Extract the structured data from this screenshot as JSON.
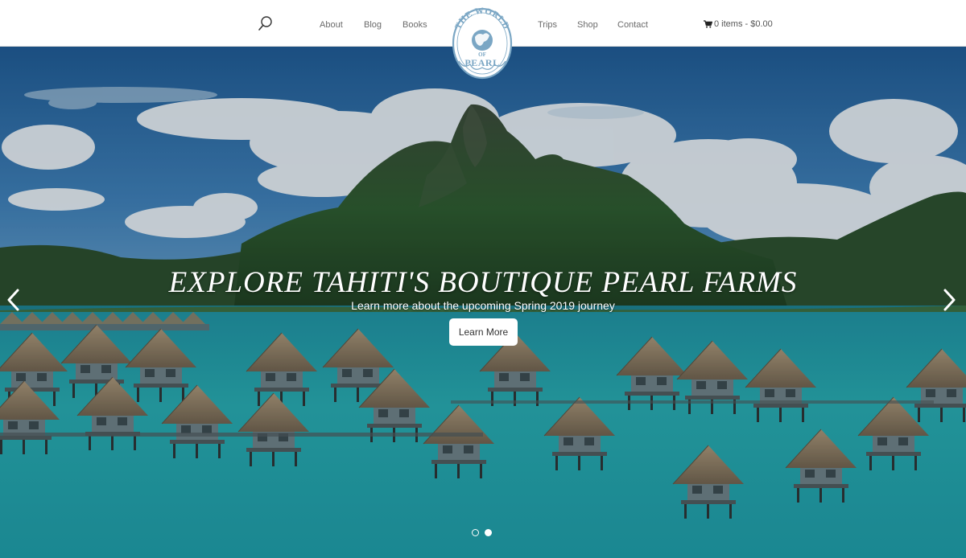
{
  "nav": {
    "left": [
      "About",
      "Blog",
      "Books"
    ],
    "right": [
      "Trips",
      "Shop",
      "Contact"
    ],
    "search_icon": "search-icon",
    "cart_label": "0 items - $0.00",
    "cart_icon": "cart-icon"
  },
  "logo": {
    "top_text": "THE WORLD",
    "middle_text": "OF",
    "bottom_text": "PEARL",
    "color": "#7aa6c4"
  },
  "hero": {
    "title": "EXPLORE TAHITI'S BOUTIQUE PEARL FARMS",
    "subtitle": "Learn more about the upcoming Spring 2019 journey",
    "button_label": "Learn More",
    "prev_icon": "chevron-left-icon",
    "next_icon": "chevron-right-icon",
    "slides_total": 2,
    "active_slide": 2
  },
  "colors": {
    "sky": "#2f6ea6",
    "lagoon": "#2aa3a6",
    "mountain": "#2e4a2c",
    "thatch": "#8a7a62"
  }
}
